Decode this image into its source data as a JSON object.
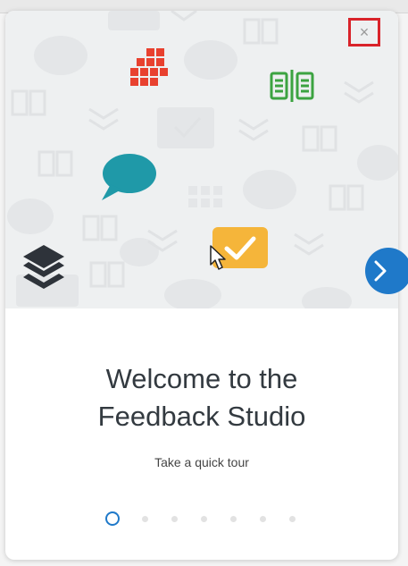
{
  "window": {
    "close_glyph": "×",
    "next_glyph": "›"
  },
  "welcome": {
    "title_line1": "Welcome to the",
    "title_line2": "Feedback Studio",
    "subtitle": "Take a quick tour"
  },
  "pagination": {
    "current_page": 1,
    "total_pages": 7
  },
  "icons": {
    "grid": "grid-icon",
    "book": "open-book-icon",
    "chat": "speech-bubble-icon",
    "check": "checkmark-icon",
    "layers": "layers-icon"
  },
  "colors": {
    "grid_icon": "#e8412f",
    "book_icon": "#3ca341",
    "chat_icon": "#1f99a8",
    "check_icon": "#f5b53a",
    "layers_icon": "#2e333a",
    "accent_blue": "#1f79c9",
    "close_highlight": "#d9232a"
  }
}
